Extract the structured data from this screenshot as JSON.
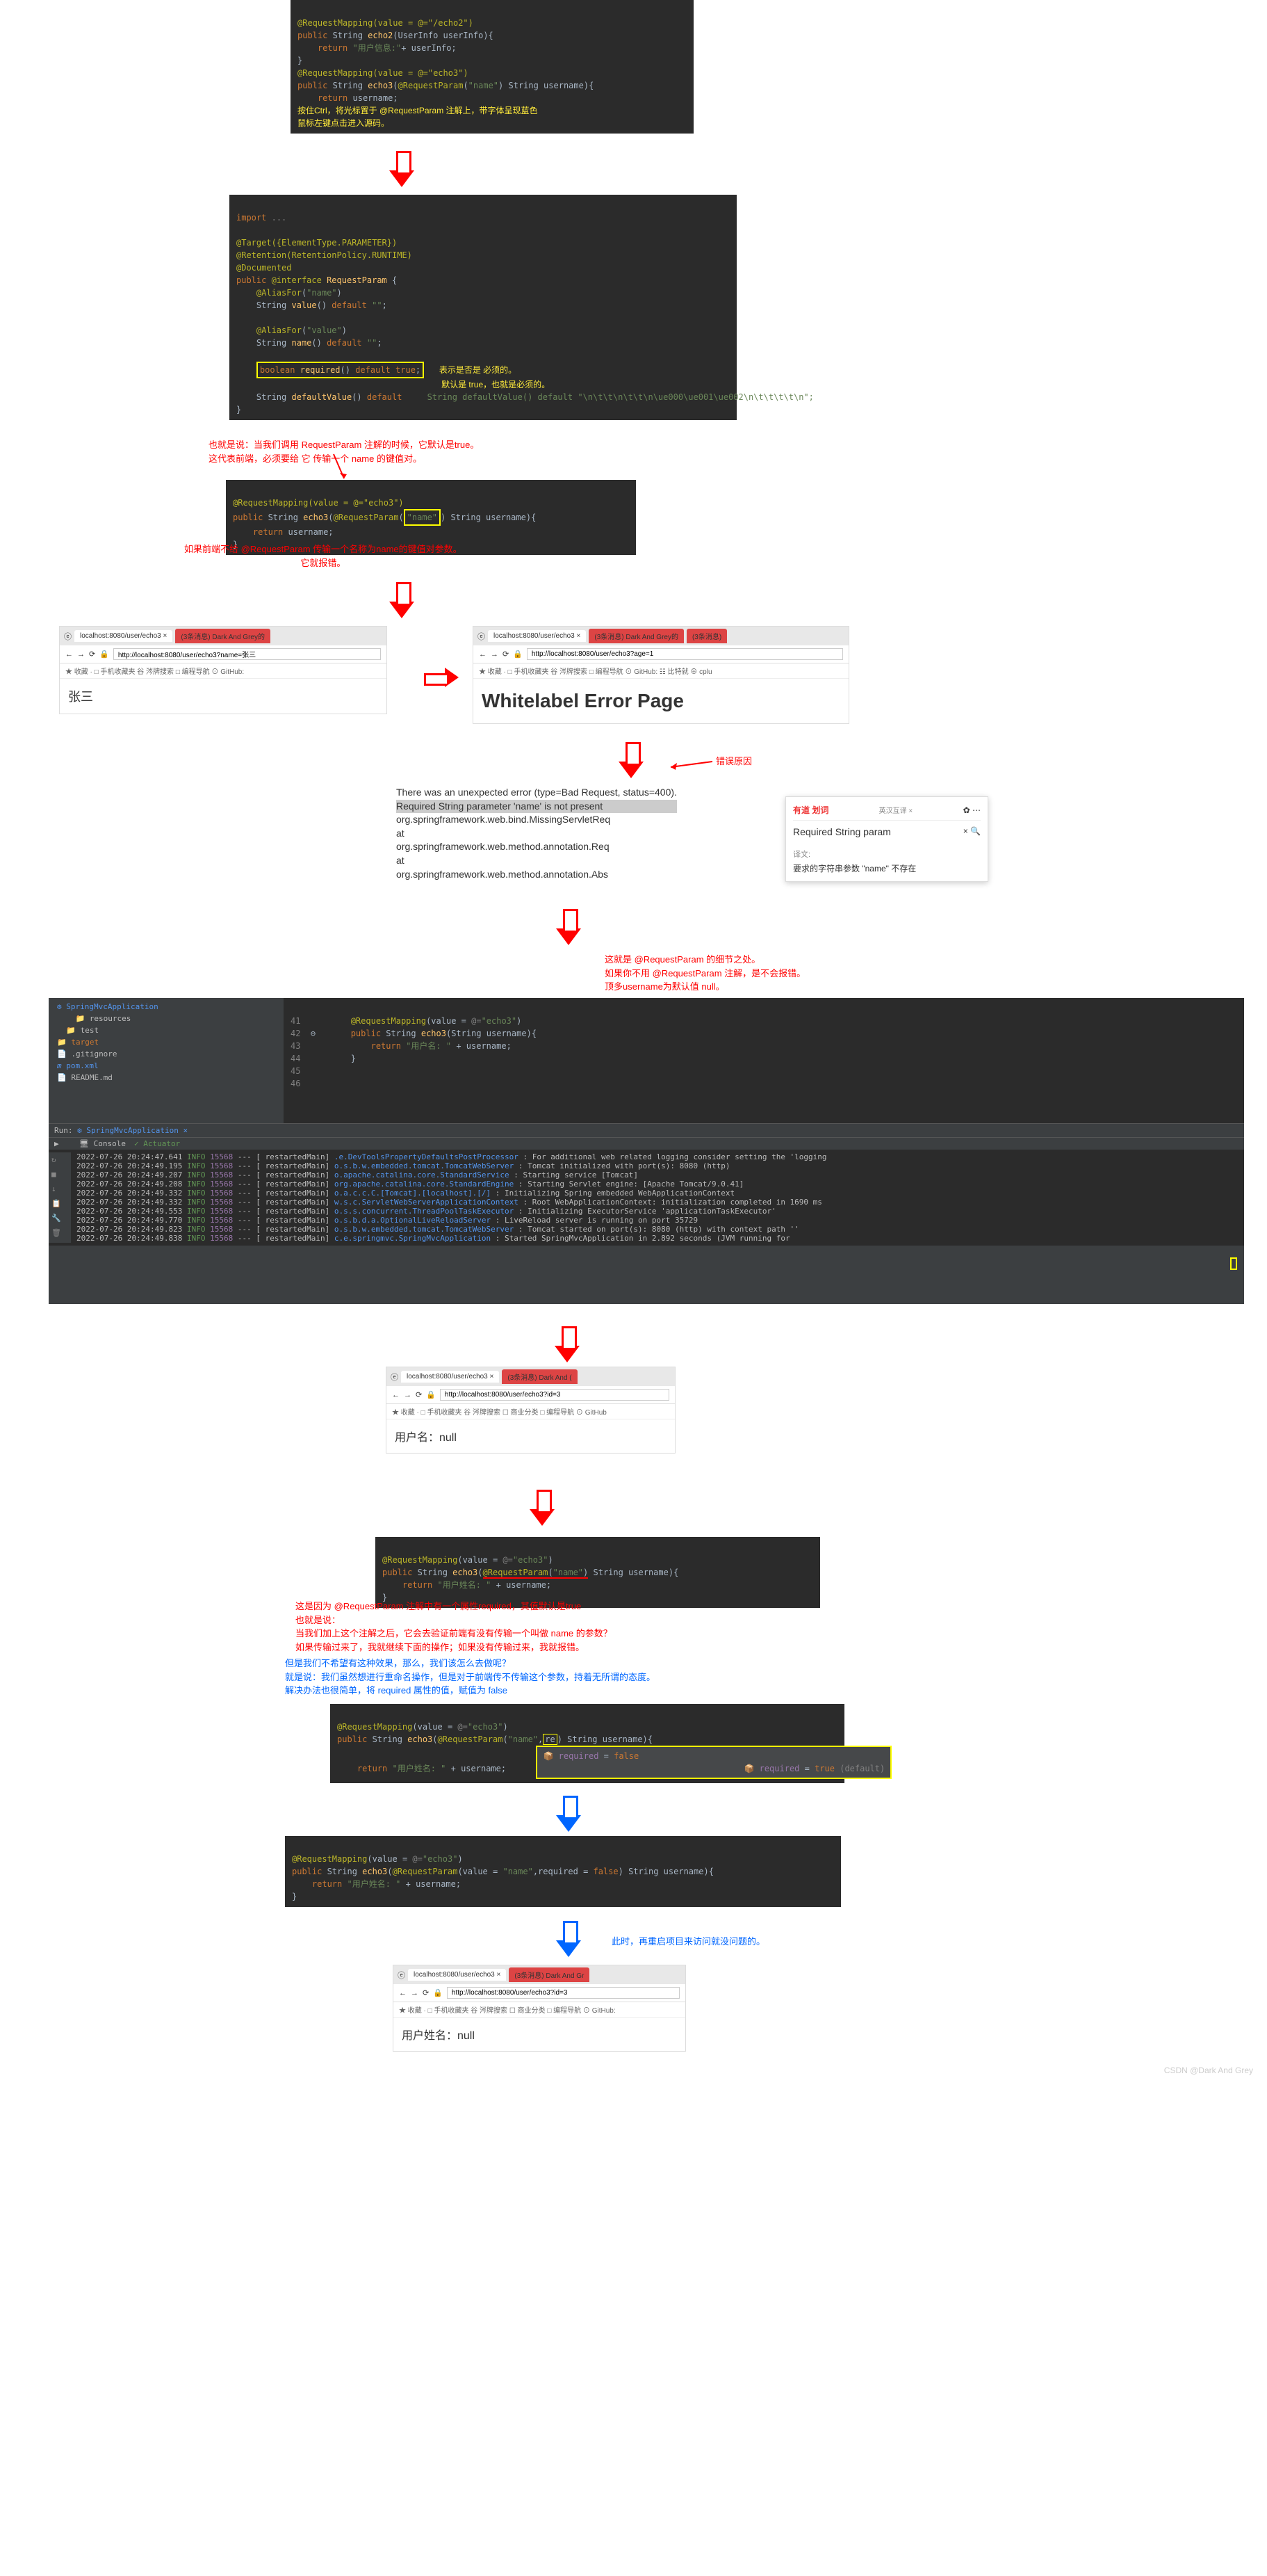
{
  "code1": {
    "l1": "@RequestMapping(value = @=\"/echo2\")",
    "l2": "public String echo2(UserInfo userInfo){",
    "l3": "    return \"用户信息:\"+ userInfo;",
    "l4": "}",
    "l5": "@RequestMapping(value = @=\"echo3\")",
    "l6": "public String echo3(@RequestParam(\"name\") String username){",
    "l7": "    return username;",
    "note1": "按住Ctrl，将光标置于 @RequestParam 注解上，带字体呈现蓝色",
    "note2": "鼠标左键点击进入源码。"
  },
  "code2": {
    "l0": "import ...",
    "l1": "@Target({ElementType.PARAMETER})",
    "l2": "@Retention(RetentionPolicy.RUNTIME)",
    "l3": "@Documented",
    "l4": "public @interface RequestParam {",
    "l5": "    @AliasFor(\"name\")",
    "l6": "    String value() default \"\";",
    "l7": "    @AliasFor(\"value\")",
    "l8": "    String name() default \"\";",
    "l9": "    boolean required() default true;",
    "note1": "表示是否是 必须的。",
    "note2": "    默认是 true，也就是必须的。",
    "l10": "    String defaultValue() default \"\\n\\t\\t\\n\\t\\t\\n\\ue000\\ue001\\ue002\\n\\t\\t\\t\\t\\n\";",
    "l11": "}"
  },
  "redtext1": {
    "l1": "也就是说：当我们调用 RequestParam 注解的时候，它默认是true。",
    "l2": "这代表前端，必须要给 它 传输一个 name 的键值对。"
  },
  "code3": {
    "l1": "@RequestMapping(value = @=\"echo3\")",
    "l2": "public String echo3(@RequestParam(\"name\") String username){",
    "l3": "    return username;",
    "l4": "}"
  },
  "redtext2": {
    "l1": "如果前端不给 @RequestParam 传输一个名称为name的键值对参数。",
    "l2": "它就报错。"
  },
  "browser1": {
    "tab1": "localhost:8080/user/echo3",
    "tab2": "(3条消息) Dark And Grey的",
    "url": "http://localhost:8080/user/echo3?name=张三",
    "bookmarks": "★ 收藏 · □ 手机收藏夹 谷 涔牌搜索 □ 编程导航 ⊙ GitHub: ",
    "content": "张三"
  },
  "browser2": {
    "tab1": "localhost:8080/user/echo3",
    "tab2": "(3条消息) Dark And Grey的",
    "tab3": "(3条消息)",
    "url": "http://localhost:8080/user/echo3?age=1",
    "bookmarks": "★ 收藏 · □ 手机收藏夹 谷 涔牌搜索 □ 编程导航 ⊙ GitHub: ☷ 比特就 ⊕ cplu",
    "title": "Whitelabel Error Page"
  },
  "error_label": "错误原因",
  "error": {
    "l1": "There was an unexpected error (type=Bad Request, status=400).",
    "l2": "Required String parameter 'name' is not present",
    "l3": "org.springframework.web.bind.MissingServletReq",
    "l4": "     at",
    "l5": "org.springframework.web.method.annotation.Req",
    "l6": "     at",
    "l7": "org.springframework.web.method.annotation.Abs"
  },
  "dict": {
    "brand": "有道 划词",
    "mode": "英汉互译 ×",
    "query": "Required String param",
    "label": "译文:",
    "translation": "要求的字符串参数 \"name\" 不存在"
  },
  "redtext3": {
    "l1": "这就是 @RequestParam 的细节之处。",
    "l2": "如果你不用 @RequestParam 注解，是不会报错。",
    "l3": "顶多username为默认值 null。"
  },
  "ide": {
    "title": "SpringMvcApplication",
    "tree": [
      "resources",
      "test",
      "target",
      ".gitignore",
      "pom.xml",
      "README.md"
    ],
    "run": "Run:",
    "tab": "SpringMvcApplication ×",
    "toolbar": [
      "Console",
      "Actuator"
    ],
    "code": {
      "ln41": "41",
      "l41": "        @RequestMapping(value = @=\"echo3\")",
      "ln42": "42",
      "l42": "        public String echo3(String username){",
      "ln43": "43",
      "l43": "            return \"用户名: \" + username;",
      "ln44": "44",
      "l44": "        }",
      "ln45": "45",
      "ln46": "46"
    }
  },
  "logs": [
    {
      "t": "2022-07-26 20:24:47.641",
      "lv": "INFO",
      "pid": "15568",
      "th": "[  restartedMain]",
      "cls": ".e.DevToolsPropertyDefaultsPostProcessor",
      "msg": ": For additional web related logging consider setting the 'logging"
    },
    {
      "t": "2022-07-26 20:24:49.195",
      "lv": "INFO",
      "pid": "15568",
      "th": "[  restartedMain]",
      "cls": "o.s.b.w.embedded.tomcat.TomcatWebServer",
      "msg": ": Tomcat initialized with port(s): 8080 (http)"
    },
    {
      "t": "2022-07-26 20:24:49.207",
      "lv": "INFO",
      "pid": "15568",
      "th": "[  restartedMain]",
      "cls": "o.apache.catalina.core.StandardService",
      "msg": ": Starting service [Tomcat]"
    },
    {
      "t": "2022-07-26 20:24:49.208",
      "lv": "INFO",
      "pid": "15568",
      "th": "[  restartedMain]",
      "cls": "org.apache.catalina.core.StandardEngine",
      "msg": ": Starting Servlet engine: [Apache Tomcat/9.0.41]"
    },
    {
      "t": "2022-07-26 20:24:49.332",
      "lv": "INFO",
      "pid": "15568",
      "th": "[  restartedMain]",
      "cls": "o.a.c.c.C.[Tomcat].[localhost].[/]",
      "msg": ": Initializing Spring embedded WebApplicationContext"
    },
    {
      "t": "2022-07-26 20:24:49.332",
      "lv": "INFO",
      "pid": "15568",
      "th": "[  restartedMain]",
      "cls": "w.s.c.ServletWebServerApplicationContext",
      "msg": ": Root WebApplicationContext: initialization completed in 1690 ms"
    },
    {
      "t": "2022-07-26 20:24:49.553",
      "lv": "INFO",
      "pid": "15568",
      "th": "[  restartedMain]",
      "cls": "o.s.s.concurrent.ThreadPoolTaskExecutor",
      "msg": ": Initializing ExecutorService 'applicationTaskExecutor'"
    },
    {
      "t": "2022-07-26 20:24:49.770",
      "lv": "INFO",
      "pid": "15568",
      "th": "[  restartedMain]",
      "cls": "o.s.b.d.a.OptionalLiveReloadServer",
      "msg": ": LiveReload server is running on port 35729"
    },
    {
      "t": "2022-07-26 20:24:49.823",
      "lv": "INFO",
      "pid": "15568",
      "th": "[  restartedMain]",
      "cls": "o.s.b.w.embedded.tomcat.TomcatWebServer",
      "msg": ": Tomcat started on port(s): 8080 (http) with context path ''"
    },
    {
      "t": "2022-07-26 20:24:49.838",
      "lv": "INFO",
      "pid": "15568",
      "th": "[  restartedMain]",
      "cls": "c.e.springmvc.SpringMvcApplication",
      "msg": ": Started SpringMvcApplication in 2.892 seconds (JVM running for "
    }
  ],
  "browser3": {
    "tab1": "localhost:8080/user/echo3",
    "tab2": "(3条消息) Dark And (",
    "url": "http://localhost:8080/user/echo3?id=3",
    "bookmarks": "★ 收藏 · □ 手机收藏夹 谷 涔牌搜索 ☐ 商业分类 □ 编程导航 ⊙ GitHub",
    "content": "用户名：null"
  },
  "code5": {
    "l1": "@RequestMapping(value = @=\"echo3\")",
    "l2": "public String echo3(@RequestParam(\"name\") String username){",
    "l3": "    return \"用户姓名: \" + username;",
    "l4": "}"
  },
  "redtext4": {
    "l1": "这是因为 @RequestParam 注解中有一个属性required，其值默认是true",
    "l2": "也就是说：",
    "l3": "    当我们加上这个注解之后，它会去验证前端有没有传输一个叫做 name 的参数？",
    "l4": "    如果传输过来了，我就继续下面的操作；如果没有传输过来，我就报错。"
  },
  "bluetext1": {
    "l1": "    但是我们不希望有这种效果，那么，我们该怎么去做呢？",
    "l2": "就是说：我们虽然想进行重命名操作，但是对于前端传不传输这个参数，持着无所谓的态度。",
    "l3": "              解决办法也很简单，将 required 属性的值，赋值为 false"
  },
  "code6": {
    "l1": "@RequestMapping(value = @=\"echo3\")",
    "l2": "public String echo3(@RequestParam(\"name\",re) String username){",
    "l3": "    return \"用户姓名: \" + username;",
    "popup1": "required = false",
    "popup2": "required = true (default)"
  },
  "code7": {
    "l1": "@RequestMapping(value = @=\"echo3\")",
    "l2": "public String echo3(@RequestParam(value = \"name\",required = false) String username){",
    "l3": "    return \"用户姓名: \" + username;",
    "l4": "}"
  },
  "bluetext2": "此时，再重启项目来访问就没问题的。",
  "browser4": {
    "tab1": "localhost:8080/user/echo3",
    "tab2": "(3条消息) Dark And Gr",
    "url": "http://localhost:8080/user/echo3?id=3",
    "bookmarks": "★ 收藏 · □ 手机收藏夹 谷 涔牌搜索 ☐ 商业分类 □ 编程导航 ⊙ GitHub:",
    "content": "用户姓名：null"
  },
  "watermark": "CSDN @Dark And Grey"
}
